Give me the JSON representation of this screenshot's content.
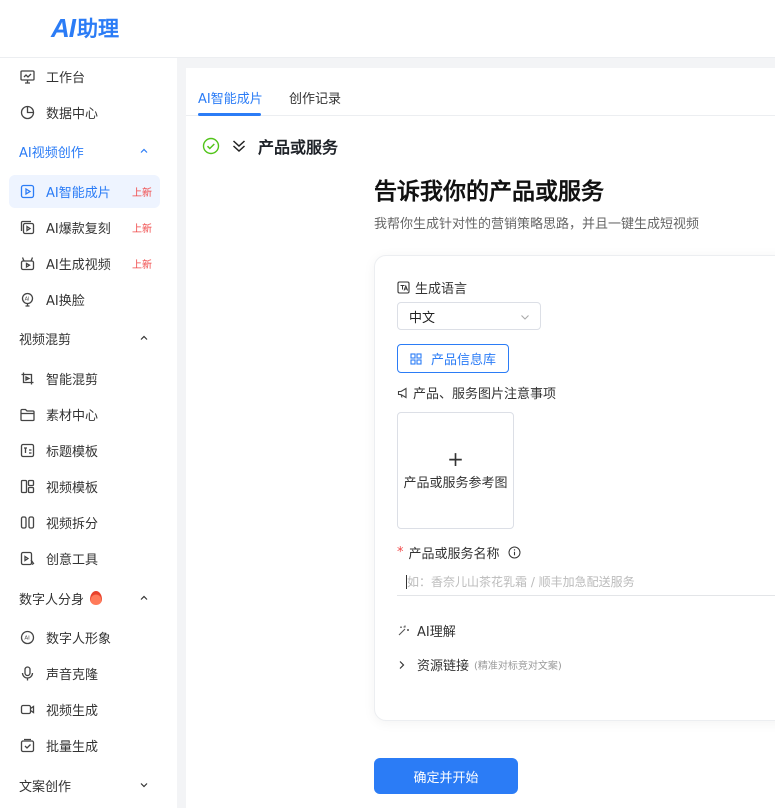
{
  "logo": {
    "mark": "AI",
    "text": "助理"
  },
  "sidebar": {
    "workbench": "工作台",
    "data_center": "数据中心",
    "groups": {
      "ai_video": "AI视频创作",
      "mix": "视频混剪",
      "digital_human": "数字人分身",
      "copywriting": "文案创作"
    },
    "items": {
      "ai_smart": {
        "label": "AI智能成片",
        "badge": "上新"
      },
      "ai_copy": {
        "label": "AI爆款复刻",
        "badge": "上新"
      },
      "ai_gen": {
        "label": "AI生成视频",
        "badge": "上新"
      },
      "ai_face": {
        "label": "AI换脸"
      },
      "smart_mix": {
        "label": "智能混剪"
      },
      "material": {
        "label": "素材中心"
      },
      "title_tpl": {
        "label": "标题模板"
      },
      "video_tpl": {
        "label": "视频模板"
      },
      "video_split": {
        "label": "视频拆分"
      },
      "creative": {
        "label": "创意工具"
      },
      "dh_image": {
        "label": "数字人形象"
      },
      "voice": {
        "label": "声音克隆"
      },
      "video_gen": {
        "label": "视频生成"
      },
      "batch": {
        "label": "批量生成"
      }
    }
  },
  "tabs": {
    "smart": "AI智能成片",
    "history": "创作记录"
  },
  "step": {
    "title": "产品或服务"
  },
  "hero": {
    "title": "告诉我你的产品或服务",
    "subtitle": "我帮你生成针对性的营销策略思路，并且一键生成短视频"
  },
  "form": {
    "language_label": "生成语言",
    "language_value": "中文",
    "product_lib_button": "产品信息库",
    "image_notice": "产品、服务图片注意事项",
    "upload_label": "产品或服务参考图",
    "upload_plus": "+",
    "name_required": "*",
    "name_label": "产品或服务名称",
    "name_placeholder": "如：香奈儿山茶花乳霜 / 顺丰加急配送服务",
    "ai_understand": "AI理解",
    "resource_link": "资源链接",
    "resource_hint": "(精准对标竞对文案)"
  },
  "submit_button": "确定并开始",
  "colors": {
    "accent": "#2b7cf6",
    "badge": "#f04848",
    "check": "#52c41a"
  }
}
